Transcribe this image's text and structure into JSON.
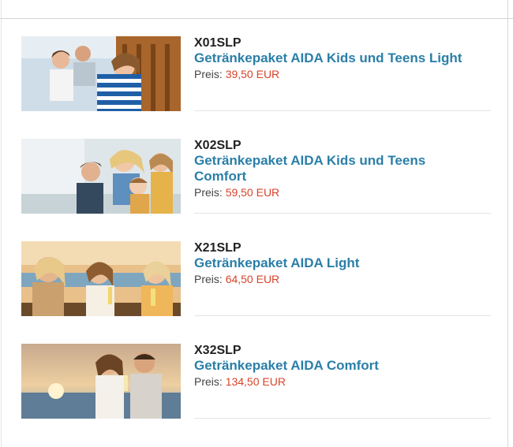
{
  "products": [
    {
      "code": "X01SLP",
      "title": "Getränkepaket AIDA Kids und Teens Light",
      "price_label": "Preis:",
      "price_value": "39,50 EUR"
    },
    {
      "code": "X02SLP",
      "title": "Getränkepaket AIDA Kids und Teens Comfort",
      "price_label": "Preis:",
      "price_value": "59,50 EUR"
    },
    {
      "code": "X21SLP",
      "title": "Getränkepaket AIDA Light",
      "price_label": "Preis:",
      "price_value": "64,50 EUR"
    },
    {
      "code": "X32SLP",
      "title": "Getränkepaket AIDA Comfort",
      "price_label": "Preis:",
      "price_value": "134,50 EUR"
    }
  ],
  "colors": {
    "title_link": "#2a7fa8",
    "price_value": "#d5442a",
    "code_text": "#222222"
  }
}
